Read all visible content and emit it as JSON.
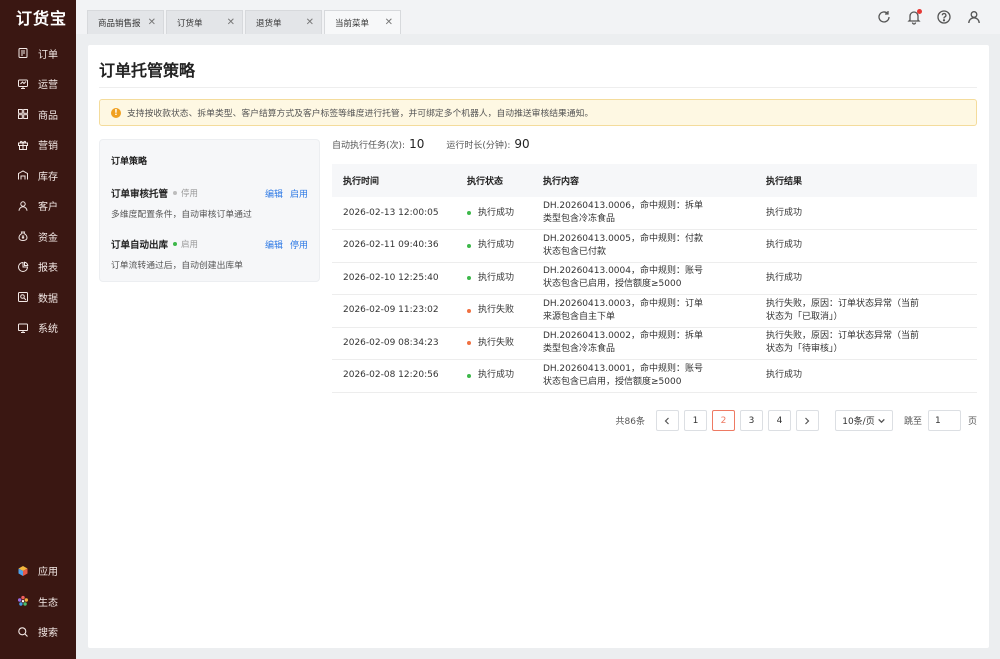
{
  "app": {
    "logo": "订货宝"
  },
  "sidebar": {
    "items": [
      {
        "label": "订单",
        "icon": "order-icon"
      },
      {
        "label": "运营",
        "icon": "operations-icon"
      },
      {
        "label": "商品",
        "icon": "products-icon"
      },
      {
        "label": "营销",
        "icon": "gift-icon"
      },
      {
        "label": "库存",
        "icon": "warehouse-icon"
      },
      {
        "label": "客户",
        "icon": "user-icon"
      },
      {
        "label": "资金",
        "icon": "money-bag-icon"
      },
      {
        "label": "报表",
        "icon": "pie-chart-icon"
      },
      {
        "label": "数据",
        "icon": "data-icon"
      },
      {
        "label": "系统",
        "icon": "monitor-icon"
      }
    ],
    "bottom": [
      {
        "label": "应用",
        "icon": "app-cube-icon"
      },
      {
        "label": "生态",
        "icon": "ecosystem-flower-icon"
      },
      {
        "label": "搜索",
        "icon": "search-icon"
      }
    ]
  },
  "tabs": [
    {
      "label": "商品销售报"
    },
    {
      "label": "订货单"
    },
    {
      "label": "退货单"
    },
    {
      "label": "当前菜单",
      "active": true
    }
  ],
  "page": {
    "title": "订单托管策略",
    "notice": "支持按收款状态、拆单类型、客户结算方式及客户标签等维度进行托管，并可绑定多个机器人，自动推送审核结果通知。"
  },
  "strategy": {
    "title": "订单策略",
    "items": [
      {
        "name": "订单审核托管",
        "status": "停用",
        "edit": "编辑",
        "toggle": "启用",
        "desc": "多维度配置条件，自动审核订单通过",
        "status_color": "#bdbdbd"
      },
      {
        "name": "订单自动出库",
        "status": "启用",
        "edit": "编辑",
        "toggle": "停用",
        "desc": "订单流转通过后，自动创建出库单",
        "status_color": "#3db84a"
      }
    ]
  },
  "stats": {
    "tasks_label": "自动执行任务(次):",
    "tasks_value": "10",
    "duration_label": "运行时长(分钟):",
    "duration_value": "90"
  },
  "table": {
    "headers": [
      "执行时间",
      "执行状态",
      "执行内容",
      "执行结果"
    ],
    "rows": [
      {
        "time": "2026-02-13 12:00:05",
        "status": "执行成功",
        "status_color": "#3db84a",
        "content": [
          "DH.20260413.0006，命中规则：拆单",
          "类型包含冷冻食品"
        ],
        "result": [
          "执行成功"
        ]
      },
      {
        "time": "2026-02-11 09:40:36",
        "status": "执行成功",
        "status_color": "#3db84a",
        "content": [
          "DH.20260413.0005，命中规则：付款",
          "状态包含已付款"
        ],
        "result": [
          "执行成功"
        ]
      },
      {
        "time": "2026-02-10 12:25:40",
        "status": "执行成功",
        "status_color": "#3db84a",
        "content": [
          "DH.20260413.0004，命中规则：账号",
          "状态包含已启用，授信额度≥5000"
        ],
        "result": [
          "执行成功"
        ]
      },
      {
        "time": "2026-02-09 11:23:02",
        "status": "执行失败",
        "status_color": "#f07040",
        "content": [
          "DH.20260413.0003，命中规则：订单",
          "来源包含自主下单"
        ],
        "result": [
          "执行失败，原因：订单状态异常（当前",
          "状态为「已取消」）"
        ]
      },
      {
        "time": "2026-02-09 08:34:23",
        "status": "执行失败",
        "status_color": "#f07040",
        "content": [
          "DH.20260413.0002，命中规则：拆单",
          "类型包含冷冻食品"
        ],
        "result": [
          "执行失败，原因：订单状态异常（当前",
          "状态为「待审核」）"
        ]
      },
      {
        "time": "2026-02-08 12:20:56",
        "status": "执行成功",
        "status_color": "#3db84a",
        "content": [
          "DH.20260413.0001，命中规则：账号",
          "状态包含已启用，授信额度≥5000"
        ],
        "result": [
          "执行成功"
        ]
      }
    ]
  },
  "pagination": {
    "total": "共86条",
    "pages": [
      "1",
      "2",
      "3",
      "4"
    ],
    "current": "2",
    "page_size": "10条/页",
    "jump_label": "跳至",
    "jump_value": "1",
    "jump_suffix": "页"
  }
}
